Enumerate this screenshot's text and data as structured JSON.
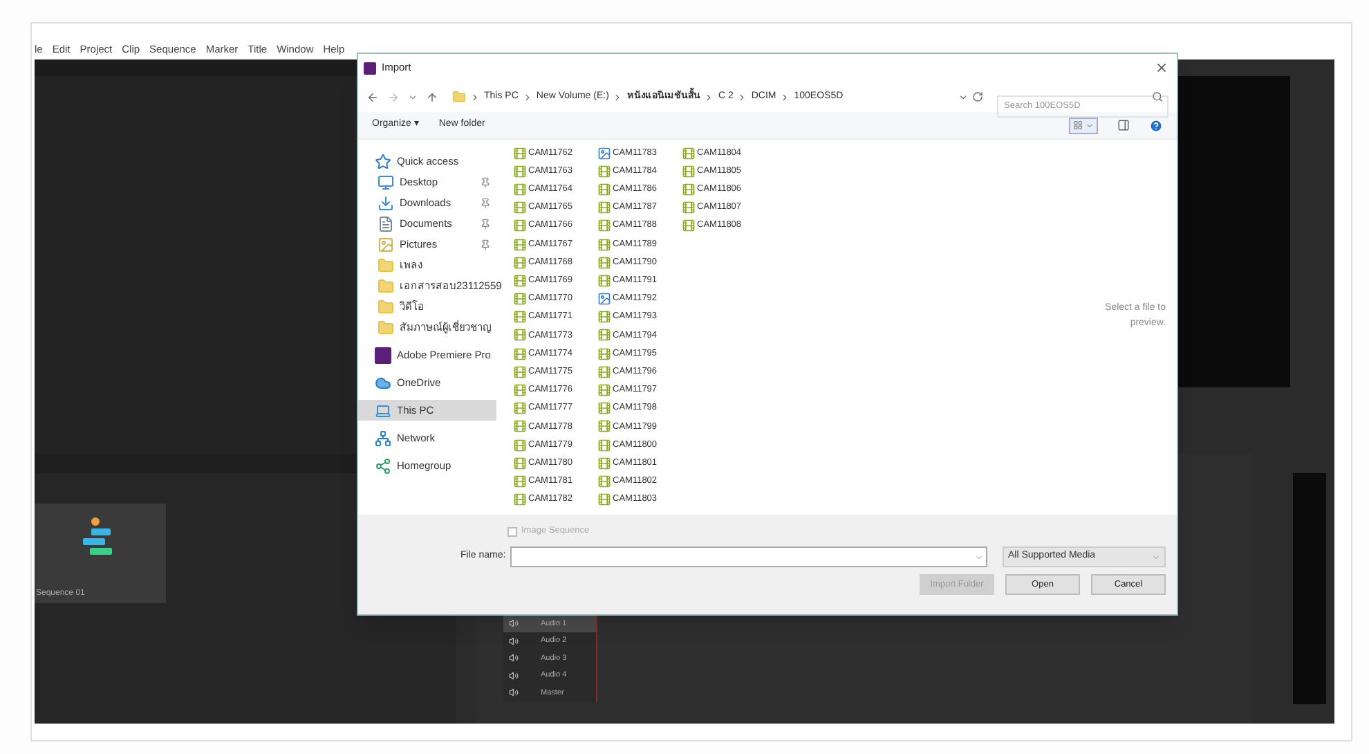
{
  "menu_bar": [
    "le",
    "Edit",
    "Project",
    "Clip",
    "Sequence",
    "Marker",
    "Title",
    "Window",
    "Help"
  ],
  "timeline": {
    "tracks": [
      {
        "label": "Audio 1",
        "selected": true
      },
      {
        "label": "Audio 2",
        "selected": false
      },
      {
        "label": "Audio 3",
        "selected": false
      },
      {
        "label": "Audio 4",
        "selected": false
      },
      {
        "label": "Master",
        "selected": false
      }
    ]
  },
  "project_panel": {
    "item_label": "Sequence 01"
  },
  "dialog": {
    "title": "Import",
    "breadcrumb": [
      "This PC",
      "New Volume (E:)",
      "หนังแอนิเมชันสั้น",
      "C 2",
      "DCIM",
      "100EOS5D"
    ],
    "search": {
      "placeholder": "Search 100EOS5D"
    },
    "toolbar": [
      "Organize ▾",
      "New folder"
    ],
    "view_toggle": {
      "selected": true
    },
    "sidebar": [
      {
        "label": "Quick access",
        "kind": "star",
        "selected": false,
        "children": [
          {
            "label": "Desktop",
            "kind": "desktop",
            "pinned": true,
            "selected": false
          },
          {
            "label": "Downloads",
            "kind": "download",
            "pinned": true,
            "selected": false
          },
          {
            "label": "Documents",
            "kind": "document",
            "pinned": true,
            "selected": false
          },
          {
            "label": "Pictures",
            "kind": "picture-folder",
            "pinned": true,
            "selected": false
          },
          {
            "label": "เพลง",
            "kind": "folder",
            "pinned": false,
            "selected": false
          },
          {
            "label": "เอกสารสอบ23112559",
            "kind": "folder",
            "pinned": false,
            "selected": false
          },
          {
            "label": "วิดีโอ",
            "kind": "folder",
            "pinned": false,
            "selected": false
          },
          {
            "label": "สัมภาษณ์ผู้เชี่ยวชาญ",
            "kind": "folder",
            "pinned": false,
            "selected": false
          }
        ]
      },
      {
        "label": "Adobe Premiere Pro",
        "kind": "premiere",
        "selected": false
      },
      {
        "label": "OneDrive",
        "kind": "cloud",
        "selected": false
      },
      {
        "label": "This PC",
        "kind": "pc",
        "selected": true
      },
      {
        "label": "Network",
        "kind": "network",
        "selected": false
      },
      {
        "label": "Homegroup",
        "kind": "homegroup",
        "selected": false
      }
    ],
    "files": [
      [
        {
          "name": "CAM11762",
          "kind": "video"
        },
        {
          "name": "CAM11763",
          "kind": "video"
        },
        {
          "name": "CAM11764",
          "kind": "video"
        },
        {
          "name": "CAM11765",
          "kind": "video"
        },
        {
          "name": "CAM11766",
          "kind": "video"
        },
        {
          "name": "CAM11767",
          "kind": "video"
        },
        {
          "name": "CAM11768",
          "kind": "video"
        },
        {
          "name": "CAM11769",
          "kind": "video"
        },
        {
          "name": "CAM11770",
          "kind": "video"
        },
        {
          "name": "CAM11771",
          "kind": "video"
        },
        {
          "name": "CAM11773",
          "kind": "video"
        },
        {
          "name": "CAM11774",
          "kind": "video"
        },
        {
          "name": "CAM11775",
          "kind": "video"
        },
        {
          "name": "CAM11776",
          "kind": "video"
        },
        {
          "name": "CAM11777",
          "kind": "video"
        },
        {
          "name": "CAM11778",
          "kind": "video"
        },
        {
          "name": "CAM11779",
          "kind": "video"
        },
        {
          "name": "CAM11780",
          "kind": "video"
        },
        {
          "name": "CAM11781",
          "kind": "video"
        },
        {
          "name": "CAM11782",
          "kind": "video"
        }
      ],
      [
        {
          "name": "CAM11783",
          "kind": "image"
        },
        {
          "name": "CAM11784",
          "kind": "video"
        },
        {
          "name": "CAM11786",
          "kind": "video"
        },
        {
          "name": "CAM11787",
          "kind": "video"
        },
        {
          "name": "CAM11788",
          "kind": "video"
        },
        {
          "name": "CAM11789",
          "kind": "video"
        },
        {
          "name": "CAM11790",
          "kind": "video"
        },
        {
          "name": "CAM11791",
          "kind": "video"
        },
        {
          "name": "CAM11792",
          "kind": "image"
        },
        {
          "name": "CAM11793",
          "kind": "video"
        },
        {
          "name": "CAM11794",
          "kind": "video"
        },
        {
          "name": "CAM11795",
          "kind": "video"
        },
        {
          "name": "CAM11796",
          "kind": "video"
        },
        {
          "name": "CAM11797",
          "kind": "video"
        },
        {
          "name": "CAM11798",
          "kind": "video"
        },
        {
          "name": "CAM11799",
          "kind": "video"
        },
        {
          "name": "CAM11800",
          "kind": "video"
        },
        {
          "name": "CAM11801",
          "kind": "video"
        },
        {
          "name": "CAM11802",
          "kind": "video"
        },
        {
          "name": "CAM11803",
          "kind": "video"
        }
      ],
      [
        {
          "name": "CAM11804",
          "kind": "video"
        },
        {
          "name": "CAM11805",
          "kind": "video"
        },
        {
          "name": "CAM11806",
          "kind": "video"
        },
        {
          "name": "CAM11807",
          "kind": "video"
        },
        {
          "name": "CAM11808",
          "kind": "video"
        }
      ]
    ],
    "preview_hint": "Select a file to preview.",
    "image_sequence": {
      "label": "Image Sequence",
      "checked": false
    },
    "file_name": {
      "label": "File name:"
    },
    "file_type": "All Supported Media",
    "buttons": [
      {
        "label": "Import Folder",
        "disabled": true
      },
      {
        "label": "Open",
        "disabled": false
      },
      {
        "label": "Cancel",
        "disabled": false
      }
    ]
  }
}
